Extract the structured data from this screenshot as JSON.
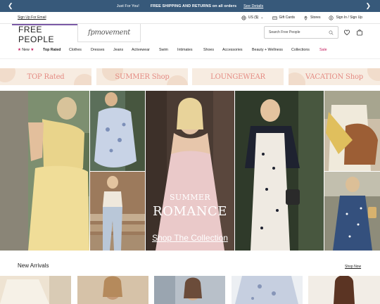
{
  "promo": {
    "pre": "Just For You!",
    "main": "FREE SHIPPING AND RETURNS on all orders",
    "link": "See Details"
  },
  "utility": {
    "email_signup": "Sign Up For Email",
    "currency": "US ($)",
    "gift_cards": "Gift Cards",
    "stores": "Stores",
    "account": "Sign In / Sign Up"
  },
  "header": {
    "logo": "FREE PEOPLE",
    "sub_brand": "fpmovement",
    "search_placeholder": "Search Free People"
  },
  "nav": {
    "items": [
      "New",
      "Top Rated",
      "Clothes",
      "Dresses",
      "Jeans",
      "Activewear",
      "Swim",
      "Intimates",
      "Shoes",
      "Accessories",
      "Beauty + Wellness",
      "Collections",
      "Sale"
    ]
  },
  "banners": {
    "items": [
      "TOP Rated",
      "SUMMER Shop",
      "LOUNGEWEAR",
      "VACATION Shop"
    ]
  },
  "hero": {
    "line1": "SUMMER",
    "line2": "ROMANCE",
    "cta": "Shop The Collection"
  },
  "new_arrivals": {
    "title": "New Arrivals",
    "link": "Shop Now"
  },
  "colors": {
    "promo_bg": "#37597a",
    "accent_pink": "#c2185b",
    "banner_bg": "#f7ece1",
    "banner_text": "#e48b83",
    "logo_rule": "#7b5aa6"
  }
}
